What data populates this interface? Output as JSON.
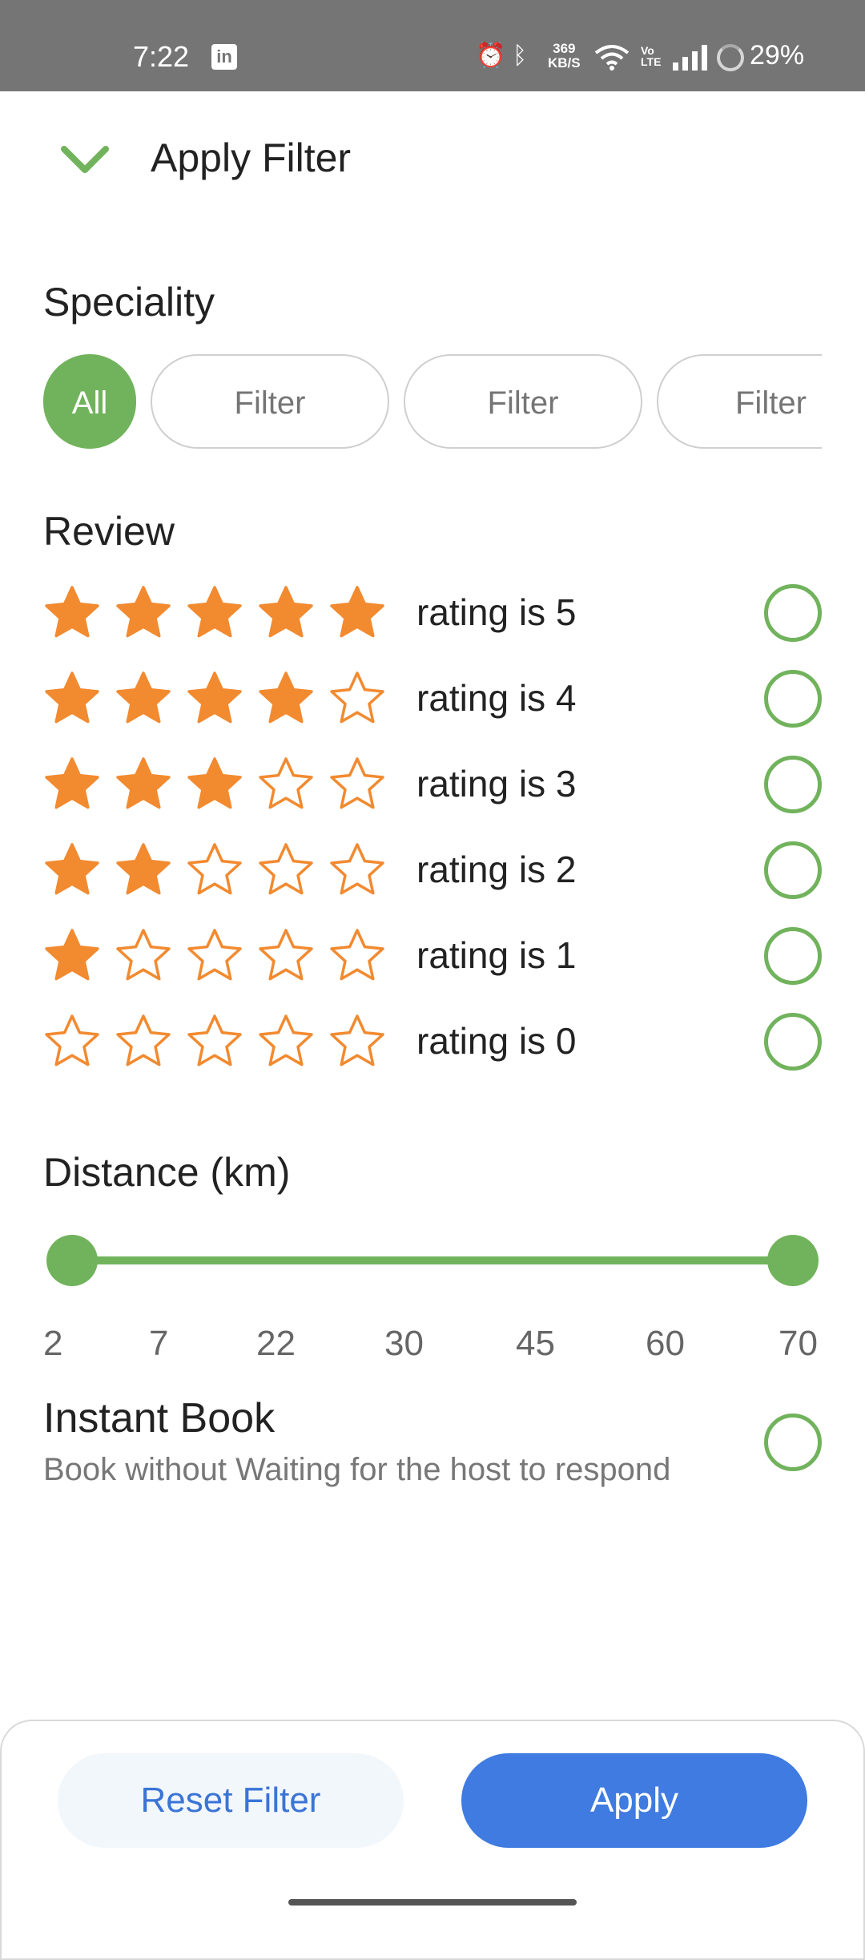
{
  "status_bar": {
    "time": "7:22",
    "linkedin_icon": "in",
    "speed_top": "369",
    "speed_bottom": "KB/S",
    "volte_top": "Vo",
    "volte_bottom": "LTE",
    "battery": "29%"
  },
  "header": {
    "title": "Apply Filter",
    "back_icon": "chevron-down-icon"
  },
  "speciality": {
    "title": "Speciality",
    "chips": [
      "All",
      "Filter",
      "Filter",
      "Filter"
    ],
    "selected": "All"
  },
  "review": {
    "title": "Review",
    "rows": [
      {
        "label": "rating is 5",
        "filled": 5
      },
      {
        "label": "rating is 4",
        "filled": 4
      },
      {
        "label": "rating is 3",
        "filled": 3
      },
      {
        "label": "rating is 2",
        "filled": 2
      },
      {
        "label": "rating is 1",
        "filled": 1
      },
      {
        "label": "rating is 0",
        "filled": 0
      }
    ],
    "star_color": "#f28a30",
    "radio_color": "#71b35c"
  },
  "distance": {
    "title": "Distance (km)",
    "ticks": [
      "2",
      "7",
      "22",
      "30",
      "45",
      "60",
      "70"
    ],
    "range": {
      "min_value": "2",
      "max_value": "70"
    },
    "accent": "#71b35c"
  },
  "instant_book": {
    "title": "Instant Book",
    "subtitle": "Book without Waiting for the host to respond"
  },
  "footer": {
    "reset_label": "Reset Filter",
    "apply_label": "Apply",
    "apply_color": "#3f7be0"
  }
}
